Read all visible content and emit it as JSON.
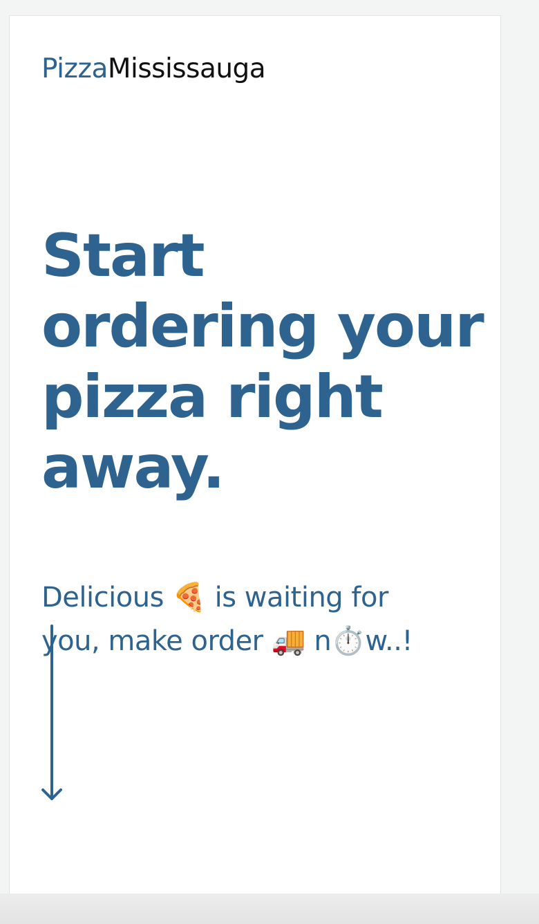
{
  "logo": {
    "part1": "Pizza",
    "part2": "Mississauga"
  },
  "hero": {
    "lines": [
      "Start",
      "ordering your",
      "pizza right",
      "away."
    ]
  },
  "subtitle": {
    "lines": [
      "Delicious 🍕 is waiting for",
      "you, make order 🚚 n⏱️w..!"
    ]
  },
  "icons": {
    "scroll": "arrow-down-icon"
  },
  "colors": {
    "accent": "#2e6390",
    "text_dark": "#111111",
    "background": "#ffffff"
  }
}
